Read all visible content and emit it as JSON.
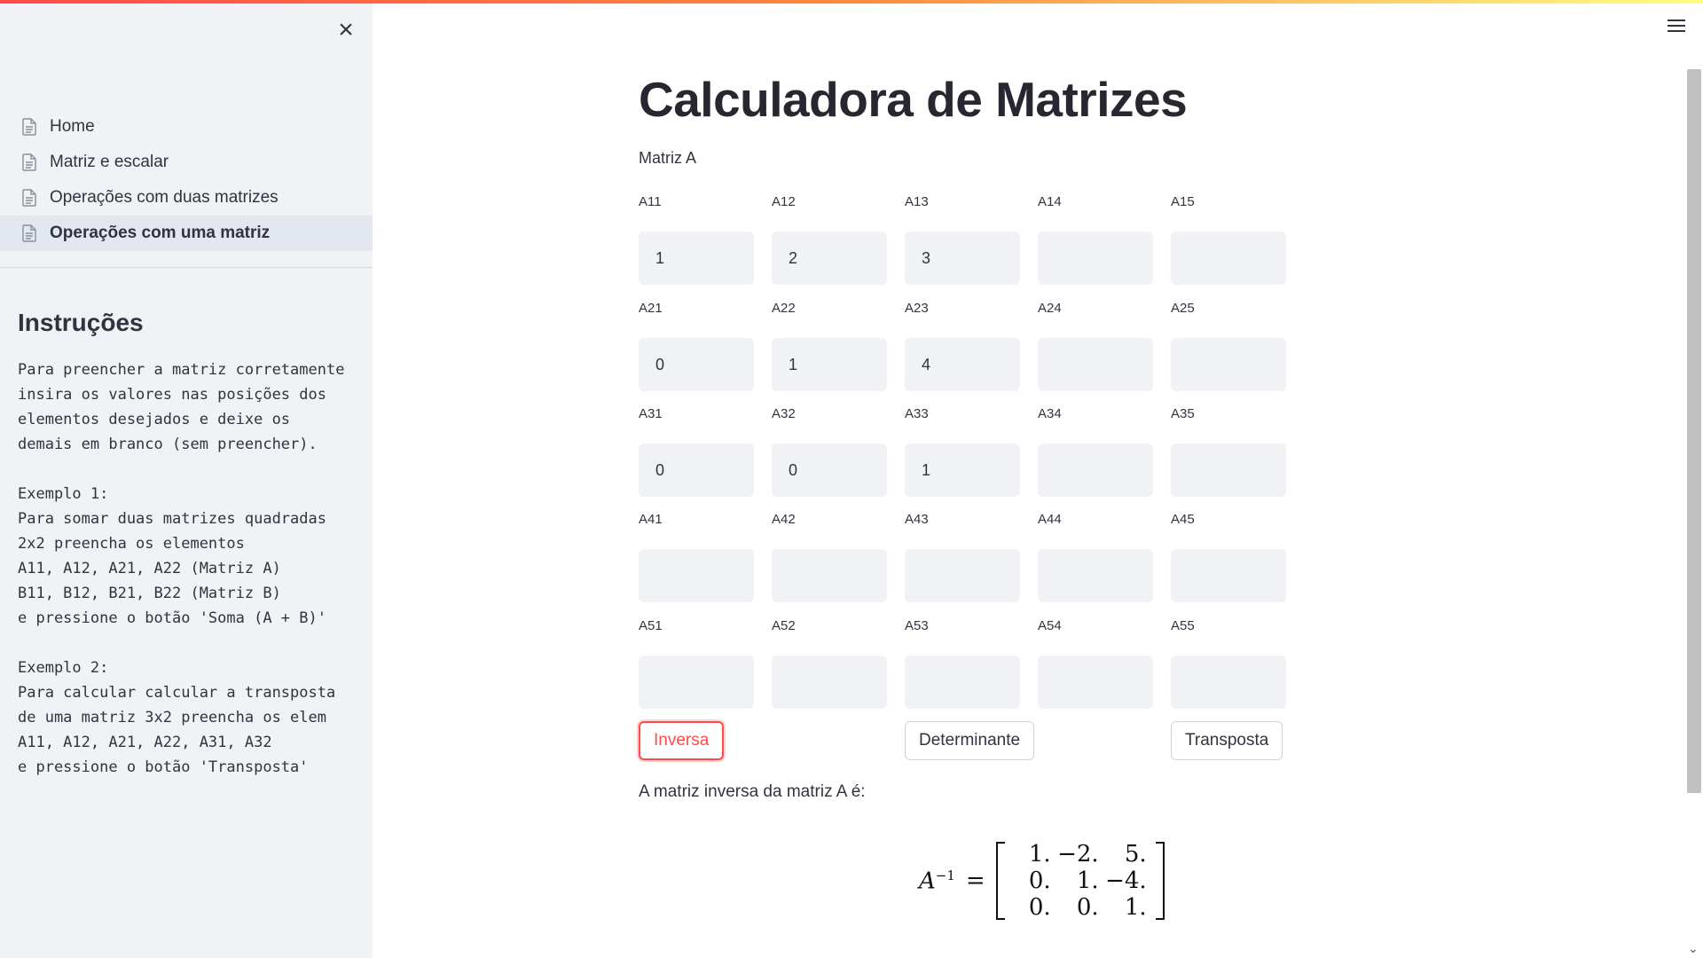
{
  "sidebar": {
    "nav": [
      {
        "label": "Home"
      },
      {
        "label": "Matriz e escalar"
      },
      {
        "label": "Operações com duas matrizes"
      },
      {
        "label": "Operações com uma matriz"
      }
    ],
    "instructions_title": "Instruções",
    "instructions_text": "Para preencher a matriz corretamente\ninsira os valores nas posições dos\nelementos desejados e deixe os\ndemais em branco (sem preencher).\n\nExemplo 1:\nPara somar duas matrizes quadradas\n2x2 preencha os elementos\nA11, A12, A21, A22 (Matriz A)\nB11, B12, B21, B22 (Matriz B)\ne pressione o botão 'Soma (A + B)'\n\nExemplo 2:\nPara calcular calcular a transposta\nde uma matriz 3x2 preencha os elem\nA11, A12, A21, A22, A31, A32\ne pressione o botão 'Transposta'"
  },
  "main": {
    "title": "Calculadora de Matrizes",
    "matrix_label": "Matriz A",
    "cells": [
      [
        {
          "label": "A11",
          "value": "1"
        },
        {
          "label": "A12",
          "value": "2"
        },
        {
          "label": "A13",
          "value": "3"
        },
        {
          "label": "A14",
          "value": ""
        },
        {
          "label": "A15",
          "value": ""
        }
      ],
      [
        {
          "label": "A21",
          "value": "0"
        },
        {
          "label": "A22",
          "value": "1"
        },
        {
          "label": "A23",
          "value": "4"
        },
        {
          "label": "A24",
          "value": ""
        },
        {
          "label": "A25",
          "value": ""
        }
      ],
      [
        {
          "label": "A31",
          "value": "0"
        },
        {
          "label": "A32",
          "value": "0"
        },
        {
          "label": "A33",
          "value": "1"
        },
        {
          "label": "A34",
          "value": ""
        },
        {
          "label": "A35",
          "value": ""
        }
      ],
      [
        {
          "label": "A41",
          "value": ""
        },
        {
          "label": "A42",
          "value": ""
        },
        {
          "label": "A43",
          "value": ""
        },
        {
          "label": "A44",
          "value": ""
        },
        {
          "label": "A45",
          "value": ""
        }
      ],
      [
        {
          "label": "A51",
          "value": ""
        },
        {
          "label": "A52",
          "value": ""
        },
        {
          "label": "A53",
          "value": ""
        },
        {
          "label": "A54",
          "value": ""
        },
        {
          "label": "A55",
          "value": ""
        }
      ]
    ],
    "buttons": {
      "inverse": "Inversa",
      "determinant": "Determinante",
      "transpose": "Transposta"
    },
    "result_text": "A matriz inversa da matriz A é:",
    "result": {
      "lhs": "A",
      "lhs_sup": "−1",
      "eq": "=",
      "rows": [
        [
          "1.",
          "−2.",
          "5."
        ],
        [
          "0.",
          "1.",
          "−4."
        ],
        [
          "0.",
          "0.",
          "1."
        ]
      ]
    }
  },
  "colors": {
    "accent": "#ff4b4b",
    "sidebar_bg": "#f0f2f6",
    "input_bg": "#f0f2f6",
    "text": "#31333f"
  },
  "icons": {
    "close": "close-icon",
    "menu": "hamburger-menu-icon",
    "page": "document-icon"
  }
}
